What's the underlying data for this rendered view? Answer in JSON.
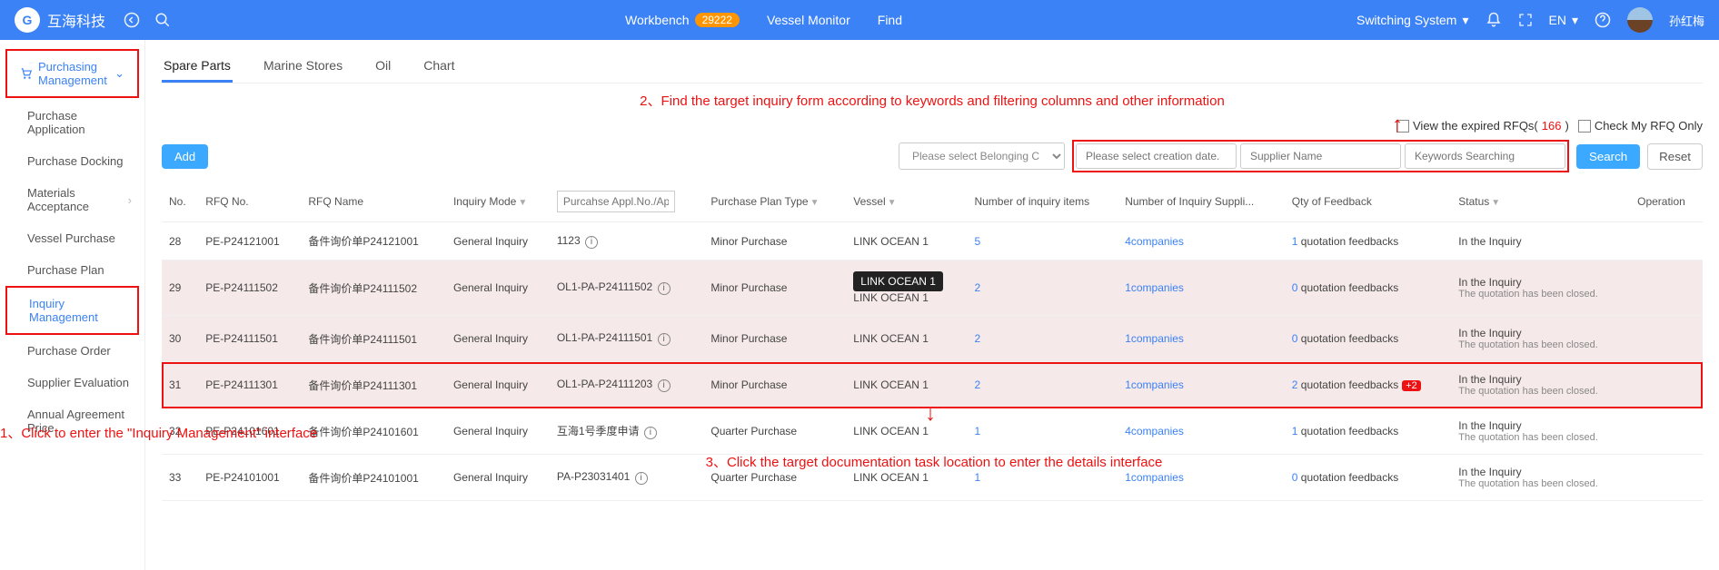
{
  "header": {
    "logo_text": "互海科技",
    "center": {
      "workbench": "Workbench",
      "workbench_count": "29222",
      "vessel_monitor": "Vessel Monitor",
      "find": "Find"
    },
    "right": {
      "switching": "Switching System",
      "lang": "EN",
      "username": "孙红梅"
    }
  },
  "sidebar": {
    "group": "Purchasing Management",
    "items": {
      "app": "Purchase Application",
      "docking": "Purchase Docking",
      "materials": "Materials Acceptance",
      "vessel": "Vessel Purchase",
      "plan": "Purchase Plan",
      "inquiry": "Inquiry Management",
      "order": "Purchase Order",
      "supplier": "Supplier Evaluation",
      "annual": "Annual Agreement Price"
    }
  },
  "tabs": {
    "spare": "Spare Parts",
    "marine": "Marine Stores",
    "oil": "Oil",
    "chart": "Chart"
  },
  "annotations": {
    "step1": "1、Click to enter the \"Inquiry Management\" interface",
    "step2": "2、Find the target inquiry form according to keywords and filtering columns and other information",
    "step3": "3、Click the target documentation task location to enter the details interface"
  },
  "controls": {
    "view_expired": "View the expired RFQs(",
    "expired_count": "166",
    "view_expired_close": ")",
    "my_rfq": "Check My RFQ Only",
    "add": "Add",
    "belonging_ph": "Please select Belonging C",
    "date_ph": "Please select creation date.",
    "supplier_ph": "Supplier Name",
    "keywords_ph": "Keywords Searching",
    "search": "Search",
    "reset": "Reset"
  },
  "table": {
    "headers": {
      "no": "No.",
      "rfq_no": "RFQ No.",
      "rfq_name": "RFQ Name",
      "inquiry_mode": "Inquiry Mode",
      "appl_no_ph": "Purcahse Appl.No./Appl",
      "plan_type": "Purchase Plan Type",
      "vessel": "Vessel",
      "num_items": "Number of inquiry items",
      "num_suppliers": "Number of Inquiry Suppli...",
      "feedback": "Qty of Feedback",
      "status": "Status",
      "operation": "Operation"
    },
    "tooltip": "LINK OCEAN 1",
    "rows": [
      {
        "no": "28",
        "rfq_no": "PE-P24121001",
        "rfq_name": "备件询价单P24121001",
        "mode": "General Inquiry",
        "appl": "1123",
        "appl_icon": true,
        "plan": "Minor Purchase",
        "vessel": "LINK OCEAN 1",
        "items": "5",
        "suppliers": "4companies",
        "fb_n": "1",
        "fb_txt": " quotation feedbacks",
        "fb_badge": "",
        "status": "In the Inquiry",
        "sub": ""
      },
      {
        "no": "29",
        "rfq_no": "PE-P24111502",
        "rfq_name": "备件询价单P24111502",
        "mode": "General Inquiry",
        "appl": "OL1-PA-P24111502",
        "appl_icon": true,
        "plan": "Minor Purchase",
        "vessel": "LINK OCEAN 1",
        "items": "2",
        "suppliers": "1companies",
        "fb_n": "0",
        "fb_txt": " quotation feedbacks",
        "fb_badge": "",
        "status": "In the Inquiry",
        "sub": "The quotation has been closed."
      },
      {
        "no": "30",
        "rfq_no": "PE-P24111501",
        "rfq_name": "备件询价单P24111501",
        "mode": "General Inquiry",
        "appl": "OL1-PA-P24111501",
        "appl_icon": true,
        "plan": "Minor Purchase",
        "vessel": "LINK OCEAN 1",
        "items": "2",
        "suppliers": "1companies",
        "fb_n": "0",
        "fb_txt": " quotation feedbacks",
        "fb_badge": "",
        "status": "In the Inquiry",
        "sub": "The quotation has been closed."
      },
      {
        "no": "31",
        "rfq_no": "PE-P24111301",
        "rfq_name": "备件询价单P24111301",
        "mode": "General Inquiry",
        "appl": "OL1-PA-P24111203",
        "appl_icon": true,
        "plan": "Minor Purchase",
        "vessel": "LINK OCEAN 1",
        "items": "2",
        "suppliers": "1companies",
        "fb_n": "2",
        "fb_txt": " quotation feedbacks",
        "fb_badge": "+2",
        "status": "In the Inquiry",
        "sub": "The quotation has been closed."
      },
      {
        "no": "32",
        "rfq_no": "PE-P24101601",
        "rfq_name": "备件询价单P24101601",
        "mode": "General Inquiry",
        "appl": "互海1号季度申请",
        "appl_icon": true,
        "plan": "Quarter Purchase",
        "vessel": "LINK OCEAN 1",
        "items": "1",
        "suppliers": "4companies",
        "fb_n": "1",
        "fb_txt": " quotation feedbacks",
        "fb_badge": "",
        "status": "In the Inquiry",
        "sub": "The quotation has been closed."
      },
      {
        "no": "33",
        "rfq_no": "PE-P24101001",
        "rfq_name": "备件询价单P24101001",
        "mode": "General Inquiry",
        "appl": "PA-P23031401",
        "appl_icon": true,
        "plan": "Quarter Purchase",
        "vessel": "LINK OCEAN 1",
        "items": "1",
        "suppliers": "1companies",
        "fb_n": "0",
        "fb_txt": " quotation feedbacks",
        "fb_badge": "",
        "status": "In the Inquiry",
        "sub": "The quotation has been closed."
      }
    ]
  }
}
